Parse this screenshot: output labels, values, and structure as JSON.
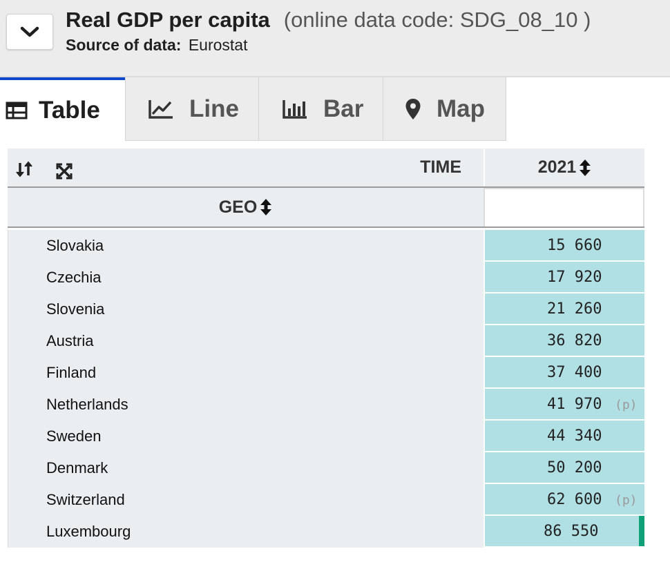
{
  "header": {
    "title": "Real GDP per capita",
    "code_text": "(online data code: SDG_08_10 )",
    "source_label": "Source of data:",
    "source_value": "Eurostat"
  },
  "tabs": [
    {
      "label": "Table",
      "icon": "table-icon",
      "active": true
    },
    {
      "label": "Line",
      "icon": "line-chart-icon",
      "active": false
    },
    {
      "label": "Bar",
      "icon": "bar-chart-icon",
      "active": false
    },
    {
      "label": "Map",
      "icon": "map-marker-icon",
      "active": false
    }
  ],
  "table": {
    "time_label": "TIME",
    "year_label": "2021",
    "geo_label": "GEO",
    "rows": [
      {
        "country": "Slovakia",
        "value": "15 660",
        "flag": ""
      },
      {
        "country": "Czechia",
        "value": "17 920",
        "flag": ""
      },
      {
        "country": "Slovenia",
        "value": "21 260",
        "flag": ""
      },
      {
        "country": "Austria",
        "value": "36 820",
        "flag": ""
      },
      {
        "country": "Finland",
        "value": "37 400",
        "flag": ""
      },
      {
        "country": "Netherlands",
        "value": "41 970",
        "flag": "(p)"
      },
      {
        "country": "Sweden",
        "value": "44 340",
        "flag": ""
      },
      {
        "country": "Denmark",
        "value": "50 200",
        "flag": ""
      },
      {
        "country": "Switzerland",
        "value": "62 600",
        "flag": "(p)"
      },
      {
        "country": "Luxembourg",
        "value": "86 550",
        "flag": ""
      }
    ]
  },
  "colors": {
    "active_tab_border": "#0e47cb",
    "value_cell_bg": "#b0dfe4",
    "highlight_mark": "#0ea179"
  }
}
